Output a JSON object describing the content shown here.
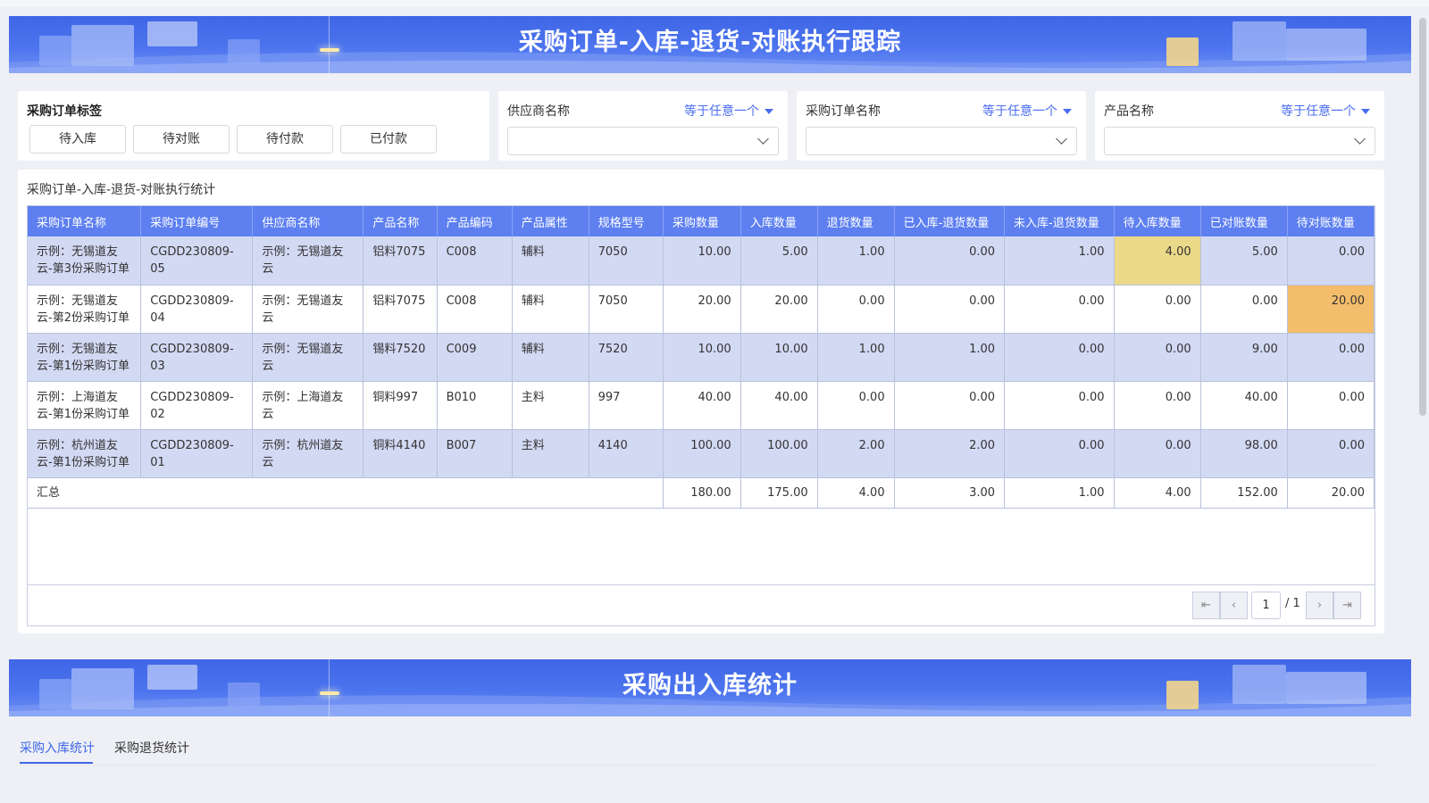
{
  "banner1": {
    "title": "采购订单-入库-退货-对账执行跟踪"
  },
  "banner2": {
    "title": "采购出入库统计"
  },
  "filters": {
    "tags": {
      "label": "采购订单标签",
      "buttons": [
        "待入库",
        "待对账",
        "待付款",
        "已付款"
      ]
    },
    "supplier": {
      "label": "供应商名称",
      "operator": "等于任意一个",
      "value": ""
    },
    "order": {
      "label": "采购订单名称",
      "operator": "等于任意一个",
      "value": ""
    },
    "product": {
      "label": "产品名称",
      "operator": "等于任意一个",
      "value": ""
    }
  },
  "table": {
    "title": "采购订单-入库-退货-对账执行统计",
    "columns": [
      "采购订单名称",
      "采购订单编号",
      "供应商名称",
      "产品名称",
      "产品编码",
      "产品属性",
      "规格型号",
      "采购数量",
      "入库数量",
      "退货数量",
      "已入库-退货数量",
      "未入库-退货数量",
      "待入库数量",
      "已对账数量",
      "待对账数量"
    ],
    "rows": [
      [
        "示例：无锡道友云-第3份采购订单",
        "CGDD230809-05",
        "示例：无锡道友云",
        "铝料7075",
        "C008",
        "辅料",
        "7050",
        "10.00",
        "5.00",
        "1.00",
        "0.00",
        "1.00",
        "4.00",
        "5.00",
        "0.00"
      ],
      [
        "示例：无锡道友云-第2份采购订单",
        "CGDD230809-04",
        "示例：无锡道友云",
        "铝料7075",
        "C008",
        "辅料",
        "7050",
        "20.00",
        "20.00",
        "0.00",
        "0.00",
        "0.00",
        "0.00",
        "0.00",
        "20.00"
      ],
      [
        "示例：无锡道友云-第1份采购订单",
        "CGDD230809-03",
        "示例：无锡道友云",
        "锡料7520",
        "C009",
        "辅料",
        "7520",
        "10.00",
        "10.00",
        "1.00",
        "1.00",
        "0.00",
        "0.00",
        "9.00",
        "0.00"
      ],
      [
        "示例：上海道友云-第1份采购订单",
        "CGDD230809-02",
        "示例：上海道友云",
        "铜料997",
        "B010",
        "主料",
        "997",
        "40.00",
        "40.00",
        "0.00",
        "0.00",
        "0.00",
        "0.00",
        "40.00",
        "0.00"
      ],
      [
        "示例：杭州道友云-第1份采购订单",
        "CGDD230809-01",
        "示例：杭州道友云",
        "铜料4140",
        "B007",
        "主料",
        "4140",
        "100.00",
        "100.00",
        "2.00",
        "2.00",
        "0.00",
        "0.00",
        "98.00",
        "0.00"
      ]
    ],
    "total": {
      "label": "汇总",
      "values": [
        "180.00",
        "175.00",
        "4.00",
        "3.00",
        "1.00",
        "4.00",
        "152.00",
        "20.00"
      ]
    },
    "highlights": {
      "yellow": "#ebd98a",
      "orange": "#f3bd6c"
    }
  },
  "pager": {
    "current": "1",
    "total": "/ 1"
  },
  "tabs": [
    "采购入库统计",
    "采购退货统计"
  ],
  "colors": {
    "primary": "#3f66e6",
    "header_bg": "#5d7ff0",
    "row_alt": "#d2d9f3"
  }
}
